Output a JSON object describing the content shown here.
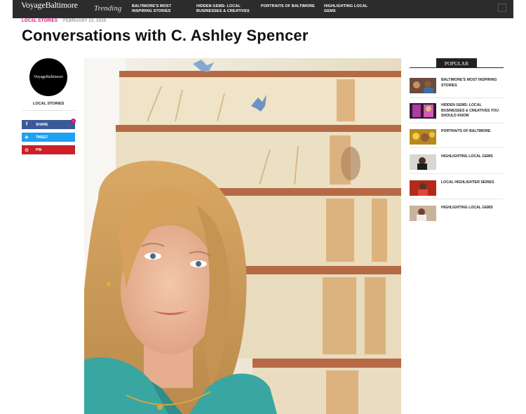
{
  "header": {
    "logo": "VoyageBaltimore",
    "trending_label": "Trending",
    "nav": [
      "BALTIMORE'S MOST INSPIRING STORIES",
      "HIDDEN GEMS: LOCAL BUSINESSES & CREATIVES",
      "PORTRAITS OF BALTIMORE",
      "HIGHLIGHTING LOCAL GEMS"
    ]
  },
  "article": {
    "category": "LOCAL STORIES",
    "date": "FEBRUARY 23, 2026",
    "title": "Conversations with C. Ashley Spencer"
  },
  "sidebar_left": {
    "avatar_text": "VoyageBaltimore",
    "label": "LOCAL STORIES",
    "share_count": "0",
    "share": [
      {
        "icon": "facebook-icon",
        "glyph": "f",
        "label": "SHARE"
      },
      {
        "icon": "twitter-icon",
        "glyph": "✈",
        "label": "TWEET"
      },
      {
        "icon": "pinterest-icon",
        "glyph": "⊙",
        "label": "PIN"
      }
    ]
  },
  "popular": {
    "heading": "POPULAR",
    "items": [
      {
        "text": "BALTIMORE'S MOST INSPIRING STORIES"
      },
      {
        "text": "HIDDEN GEMS: LOCAL BUSINESSES & CREATIVES YOU SHOULD KNOW"
      },
      {
        "text": "PORTRAITS OF BALTIMORE"
      },
      {
        "text": "HIGHLIGHTING LOCAL GEMS"
      },
      {
        "text": "LOCAL HIGHLIGHTER SERIES"
      },
      {
        "text": "HIGHLIGHTING LOCAL GEMS"
      }
    ]
  },
  "colors": {
    "accent": "#e0007a",
    "facebook": "#3b5998",
    "twitter": "#1da1f2",
    "pinterest": "#cb2027",
    "nav_bg": "#2c2c2c"
  }
}
